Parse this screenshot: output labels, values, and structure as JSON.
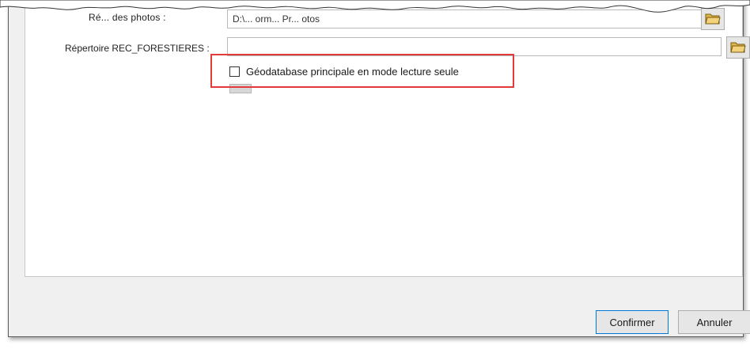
{
  "form": {
    "photos_label": "Ré... des photos :",
    "photos_value": "D:\\... orm... Pr... otos",
    "rec_label": "Répertoire REC_FORESTIERES :",
    "rec_value": "",
    "readonly_checkbox_label": "Géodatabase principale en mode lecture seule",
    "readonly_checked": false
  },
  "buttons": {
    "confirm": "Confirmer",
    "cancel": "Annuler"
  },
  "icons": {
    "folder": "folder-open-icon"
  },
  "colors": {
    "highlight": "#e33b3b",
    "folder": "#f2d27a"
  }
}
